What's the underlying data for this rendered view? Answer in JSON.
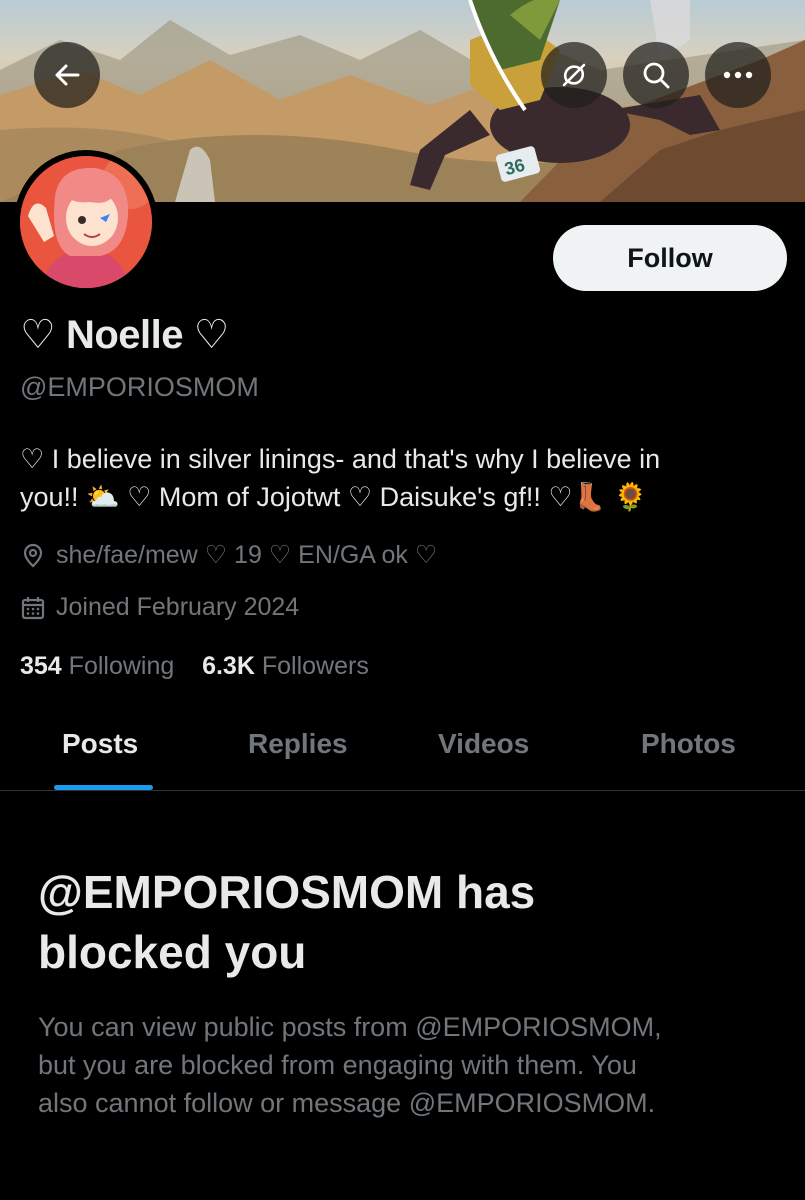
{
  "header": {
    "back_icon": "arrow-left-icon",
    "refresh_icon": "refresh-off-icon",
    "search_icon": "search-icon",
    "more_icon": "more-horizontal-icon",
    "banner_jersey_number": "36"
  },
  "profile": {
    "name": "♡ Noelle ♡",
    "handle": "@EMPORIOSMOM",
    "follow_label": "Follow",
    "bio_line1": "♡ I believe in silver linings- and that's why I believe in",
    "bio_line2": "you!! ⛅ ♡ Mom of Jojotwt ♡ Daisuke's gf!! ♡👢 🌻",
    "location": "she/fae/mew ♡ 19 ♡ EN/GA ok ♡",
    "joined": "Joined February 2024",
    "following_count": "354",
    "following_label": "Following",
    "followers_count": "6.3K",
    "followers_label": "Followers"
  },
  "tabs": [
    {
      "label": "Posts",
      "active": true
    },
    {
      "label": "Replies",
      "active": false
    },
    {
      "label": "Videos",
      "active": false
    },
    {
      "label": "Photos",
      "active": false
    }
  ],
  "blocked": {
    "title_line1": "@EMPORIOSMOM has",
    "title_line2": "blocked you",
    "text_line1": "You can view public posts from @EMPORIOSMOM,",
    "text_line2": "but you are blocked from engaging with them. You",
    "text_line3": "also cannot follow or message @EMPORIOSMOM."
  },
  "colors": {
    "background": "#000000",
    "primary_text": "#e7e9ea",
    "secondary_text": "#71767b",
    "accent": "#1d9bf0",
    "follow_bg": "#eff3f4"
  }
}
